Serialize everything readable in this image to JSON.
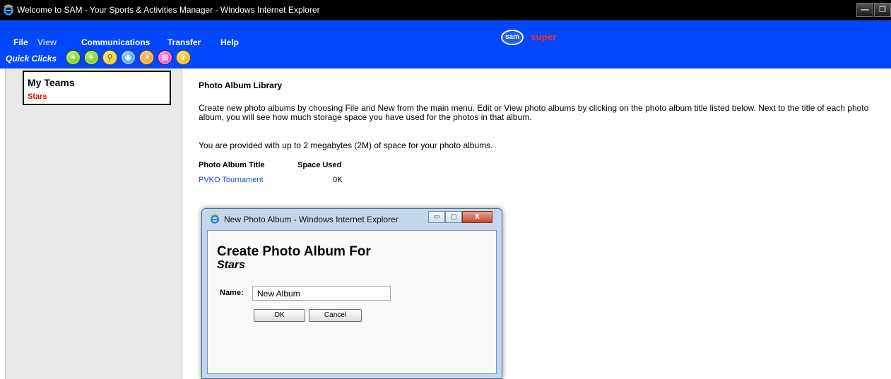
{
  "window": {
    "title": "Welcome to SAM - Your Sports & Activities Manager - Windows Internet Explorer",
    "controls": {
      "minimize": "—",
      "restore": "❐"
    }
  },
  "menu": {
    "file": "File",
    "view": "View",
    "communications": "Communications",
    "transfer": "Transfer",
    "help": "Help",
    "logo": "sam",
    "user": "super"
  },
  "quickclicks": {
    "label": "Quick Clicks",
    "icons": [
      {
        "name": "new-item-icon",
        "glyph": "+",
        "color": "#5fae1a"
      },
      {
        "name": "add-person-icon",
        "glyph": "+",
        "color": "#5fae1a"
      },
      {
        "name": "search-icon",
        "glyph": "⚲",
        "color": "#e2b400"
      },
      {
        "name": "world-icon",
        "glyph": "◉",
        "color": "#2b7de0"
      },
      {
        "name": "chart-icon",
        "glyph": "◔",
        "color": "#f08a00"
      },
      {
        "name": "document-icon",
        "glyph": "▤",
        "color": "#d01ca8"
      },
      {
        "name": "info-icon",
        "glyph": "i",
        "color": "#e09a00"
      }
    ]
  },
  "sidebar": {
    "title": "My Teams",
    "team": "Stars"
  },
  "main": {
    "title": "Photo Album Library",
    "intro": "Create new photo albums by choosing File and New from the main menu. Edit or View photo albums by clicking on the photo album title listed below. Next to the title of each photo album, you will see how much storage space you have used for the photos in that album.",
    "storage_note": "You are provided with up to 2 megabytes (2M) of space for your photo albums.",
    "columns": {
      "title": "Photo Album Title",
      "space": "Space Used"
    },
    "albums": [
      {
        "title": "PVKO Tournament",
        "space": "0K"
      }
    ]
  },
  "dialog": {
    "window_title": "New Photo Album - Windows Internet Explorer",
    "heading": "Create Photo Album For",
    "team": "Stars",
    "name_label": "Name:",
    "name_value": "New Album",
    "ok": "OK",
    "cancel": "Cancel",
    "controls": {
      "minimize": "▭",
      "maximize": "▢",
      "close": "X"
    }
  }
}
